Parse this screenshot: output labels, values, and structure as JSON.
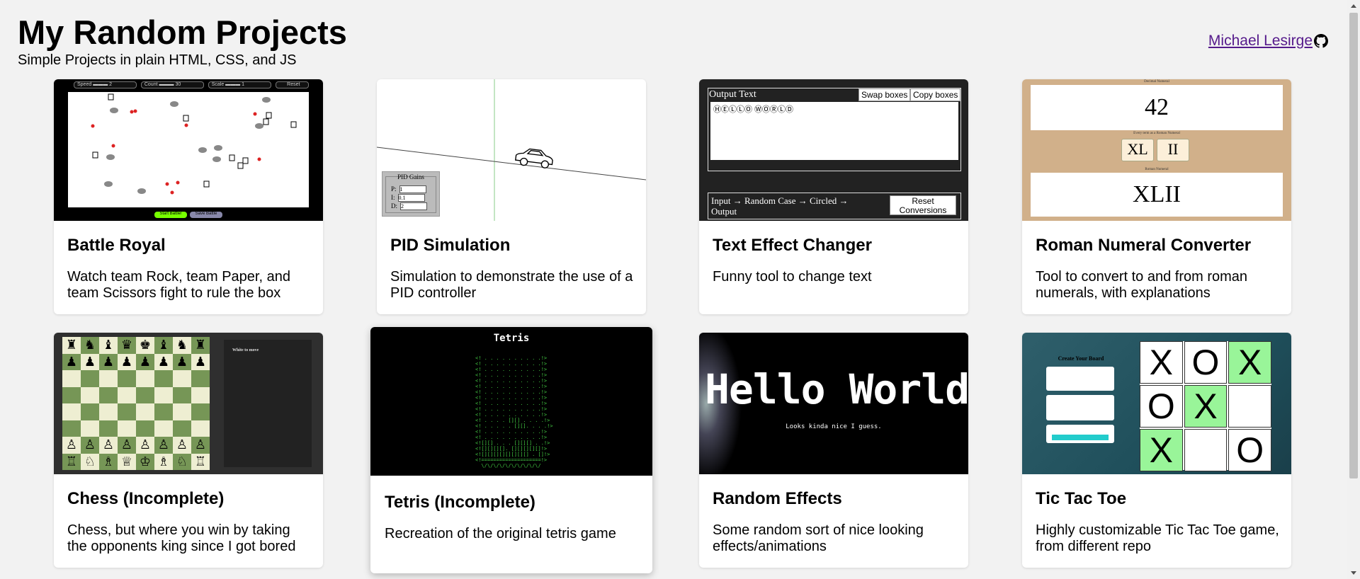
{
  "header": {
    "title": "My Random Projects",
    "subtitle": "Simple Projects in plain HTML, CSS, and JS",
    "author_link": "Michael Lesirge"
  },
  "projects": [
    {
      "title": "Battle Royal",
      "description": "Watch team Rock, team Paper, and team Scissors fight to rule the box"
    },
    {
      "title": "PID Simulation",
      "description": "Simulation to demonstrate the use of a PID controller"
    },
    {
      "title": "Text Effect Changer",
      "description": "Funny tool to change text"
    },
    {
      "title": "Roman Numeral Converter",
      "description": "Tool to convert to and from roman numerals, with explanations"
    },
    {
      "title": "Chess (Incomplete)",
      "description": "Chess, but where you win by taking the opponents king since I got bored"
    },
    {
      "title": "Tetris (Incomplete)",
      "description": "Recreation of the original tetris game"
    },
    {
      "title": "Random Effects",
      "description": "Some random sort of nice looking effects/animations"
    },
    {
      "title": "Tic Tac Toe",
      "description": "Highly customizable Tic Tac Toe game, from different repo"
    }
  ],
  "thumbs": {
    "battle": {
      "speed": "Speed",
      "speed_val": "2",
      "count": "Count",
      "count_val": "30",
      "scale": "Scale",
      "scale_val": "1",
      "reset": "Reset",
      "start": "Start Battle!",
      "save": "Save Battle"
    },
    "pid": {
      "panel_title": "PID Gains",
      "p_label": "P:",
      "p_val": "1",
      "i_label": "I:",
      "i_val": "0.1",
      "d_label": "D:",
      "d_val": "2"
    },
    "text_effect": {
      "output_label": "Output Text",
      "swap": "Swap boxes",
      "copy": "Copy boxes",
      "output_value": "ⒽⒺⓁⓁⓄ ⓌⓄⓇⓁⒹ",
      "pipeline": "Input → Random Case → Circled → Output",
      "reset": "Reset Conversions"
    },
    "roman": {
      "decimal_label": "Decimal Numeral",
      "decimal_value": "42",
      "forms_label": "Every term as a Roman Numeral",
      "chip1": "XL",
      "chip2": "II",
      "roman_label": "Roman Numeral",
      "roman_value": "XLII"
    },
    "chess": {
      "status": "White to move"
    },
    "tetris": {
      "title": "Tetris"
    },
    "effects": {
      "hello": "Hello World",
      "sub": "Looks kinda nice I guess."
    },
    "tic": {
      "panel_title": "Create Your Board",
      "board": [
        "X",
        "O",
        "X",
        "O",
        "X",
        "",
        "X",
        "",
        "O"
      ],
      "highlight": [
        false,
        false,
        true,
        false,
        true,
        false,
        true,
        false,
        false
      ]
    }
  },
  "colors": {
    "link": "#551a8b",
    "tic_highlight": "#99f599",
    "chess_light": "#eeeed2",
    "chess_dark": "#769656"
  }
}
